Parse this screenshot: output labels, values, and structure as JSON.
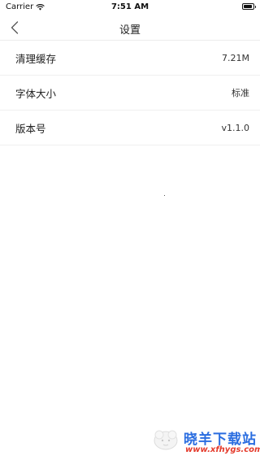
{
  "status_bar": {
    "carrier": "Carrier",
    "time": "7:51 AM",
    "battery_level": 0.95
  },
  "nav": {
    "title": "设置",
    "back_icon": "chevron-left-icon"
  },
  "settings": {
    "items": [
      {
        "label": "清理缓存",
        "value": "7.21M"
      },
      {
        "label": "字体大小",
        "value": "标准"
      },
      {
        "label": "版本号",
        "value": "v1.1.0"
      }
    ]
  },
  "watermark": {
    "title": "晓羊下载站",
    "url": "www.xfhygs.com"
  },
  "colors": {
    "watermark_title": "#2a6de0",
    "watermark_url": "#e43b2c",
    "divider": "#f0f0f0"
  }
}
